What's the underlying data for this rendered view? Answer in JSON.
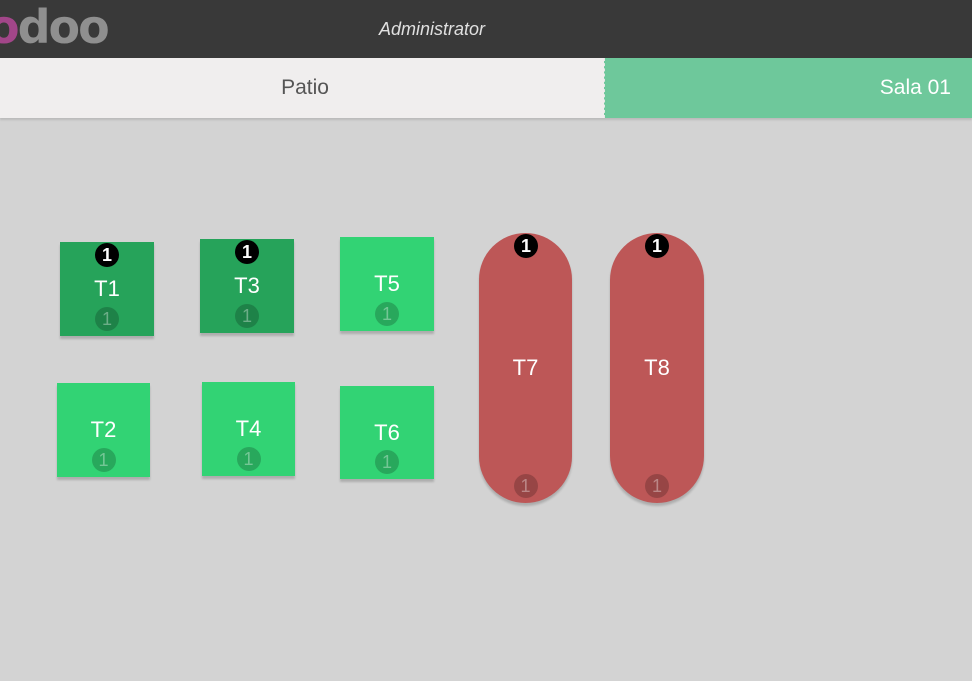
{
  "header": {
    "logo_first": "o",
    "logo_rest": "doo",
    "user": "Administrator"
  },
  "floors": [
    {
      "label": "Patio",
      "active": false
    },
    {
      "label": "Sala 01",
      "active": true
    }
  ],
  "tables": [
    {
      "name": "T1",
      "orders": "1",
      "seats": "1",
      "state": "busy"
    },
    {
      "name": "T2",
      "orders": "",
      "seats": "1",
      "state": "free"
    },
    {
      "name": "T3",
      "orders": "1",
      "seats": "1",
      "state": "busy"
    },
    {
      "name": "T4",
      "orders": "",
      "seats": "1",
      "state": "free"
    },
    {
      "name": "T5",
      "orders": "",
      "seats": "1",
      "state": "free"
    },
    {
      "name": "T6",
      "orders": "",
      "seats": "1",
      "state": "free"
    },
    {
      "name": "T7",
      "orders": "1",
      "seats": "1",
      "state": "round"
    },
    {
      "name": "T8",
      "orders": "1",
      "seats": "1",
      "state": "round"
    }
  ],
  "colors": {
    "free": "#32d374",
    "busy": "#26a35a",
    "round": "#bd5757",
    "active_floor": "#6ec89b"
  }
}
